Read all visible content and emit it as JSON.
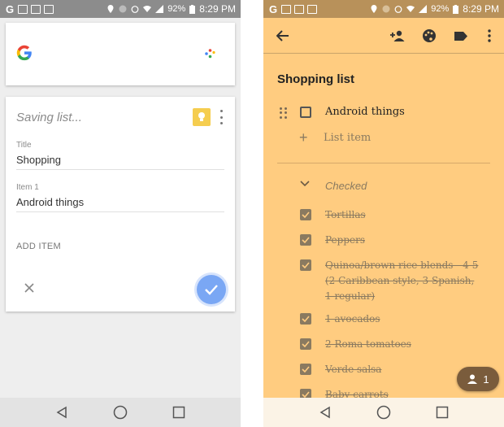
{
  "status_bar": {
    "battery": "92%",
    "time": "8:29 PM"
  },
  "left": {
    "note": {
      "saving_text": "Saving list...",
      "title_label": "Title",
      "title_value": "Shopping",
      "item_label": "Item 1",
      "item_value": "Android things",
      "add_item_label": "ADD ITEM"
    }
  },
  "right": {
    "title": "Shopping list",
    "unchecked_items": [
      "Android things"
    ],
    "list_item_placeholder": "List item",
    "checked_label": "Checked",
    "checked_items": [
      "Tortillas",
      "Peppers",
      "Quinoa/brown rice blends - 4-5 (2 Caribbean style, 3 Spanish, 1 regular)",
      "1 avocados",
      "2 Roma tomatoes",
      "Verde salsa",
      "Baby carrots"
    ],
    "collaborator_count": "1"
  },
  "colors": {
    "note_background": "#ffcc80",
    "fab_blue": "#7aa7f4",
    "keep_yellow": "#f5cd4f"
  }
}
